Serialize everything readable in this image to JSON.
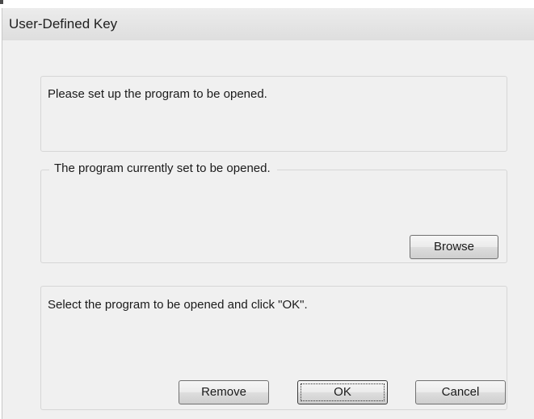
{
  "window": {
    "title": "User-Defined Key"
  },
  "instruction_group": {
    "text": "Please set up the program to be opened."
  },
  "current_program_group": {
    "legend": "The program currently set to be opened.",
    "browse_label": "Browse"
  },
  "select_group": {
    "text": "Select the program to be opened and click \"OK\".",
    "remove_label": "Remove",
    "ok_label": "OK",
    "cancel_label": "Cancel"
  },
  "colors": {
    "dialog_background": "#f0f0f0",
    "group_border": "#d6d6d6",
    "button_border": "#707070"
  }
}
